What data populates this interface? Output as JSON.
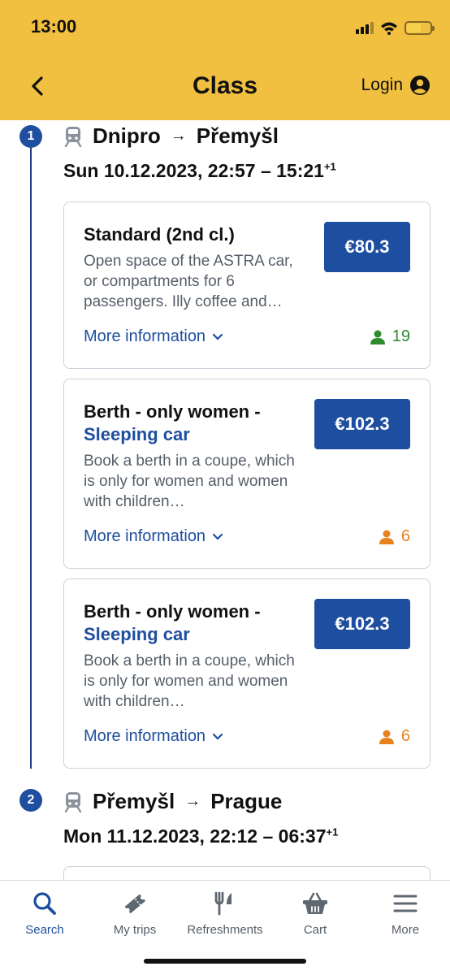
{
  "status_bar": {
    "time": "13:00"
  },
  "header": {
    "title": "Class",
    "login_label": "Login"
  },
  "segments": [
    {
      "step": "1",
      "from": "Dnipro",
      "to": "Přemyšl",
      "datetime": "Sun 10.12.2023, 22:57 – 15:21",
      "day_offset": "+1",
      "cards": [
        {
          "title": "Standard (2nd cl.)",
          "subtitle": "",
          "description": "Open space of the ASTRA car, or compartments for 6 passengers. Illy coffee and…",
          "price": "€80.3",
          "more_label": "More information",
          "seats": "19",
          "seats_color": "#2e8b2e"
        },
        {
          "title": "Berth - only women -",
          "subtitle": "Sleeping car",
          "description": "Book a berth in a coupe, which is only for women and women with children…",
          "price": "€102.3",
          "more_label": "More information",
          "seats": "6",
          "seats_color": "#e8821e"
        },
        {
          "title": "Berth - only women -",
          "subtitle": "Sleeping car",
          "description": "Book a berth in a coupe, which is only for women and women with children…",
          "price": "€102.3",
          "more_label": "More information",
          "seats": "6",
          "seats_color": "#e8821e"
        }
      ]
    },
    {
      "step": "2",
      "from": "Přemyšl",
      "to": "Prague",
      "datetime": "Mon 11.12.2023, 22:12 – 06:37",
      "day_offset": "+1"
    }
  ],
  "tabbar": {
    "items": [
      {
        "label": "Search",
        "icon": "search-icon",
        "active": true
      },
      {
        "label": "My trips",
        "icon": "ticket-icon",
        "active": false
      },
      {
        "label": "Refreshments",
        "icon": "fork-knife-icon",
        "active": false
      },
      {
        "label": "Cart",
        "icon": "basket-icon",
        "active": false
      },
      {
        "label": "More",
        "icon": "menu-icon",
        "active": false
      }
    ]
  },
  "colors": {
    "header_bg": "#f2c041",
    "accent": "#1e4ea0",
    "available_green": "#2e8b2e",
    "limited_orange": "#e8821e"
  }
}
